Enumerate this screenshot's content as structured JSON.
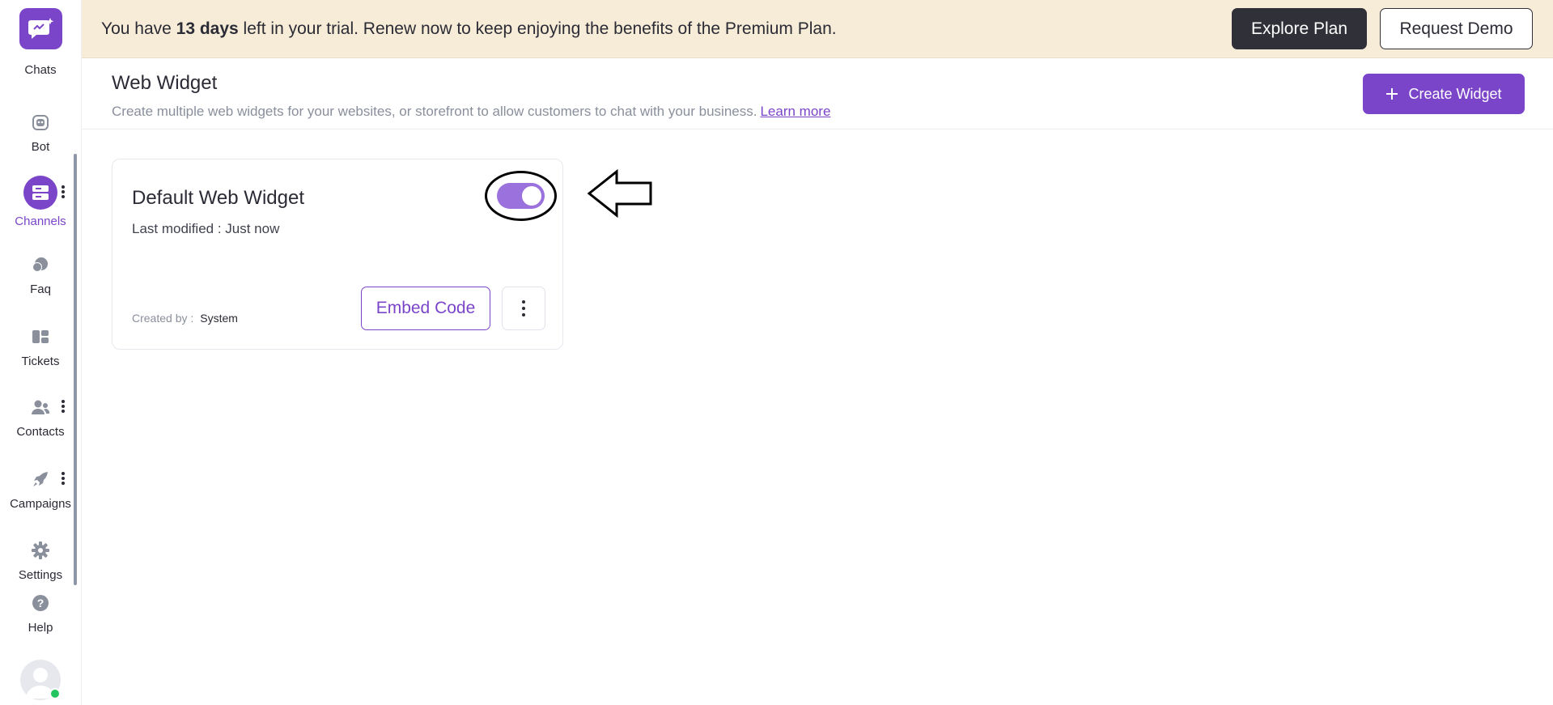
{
  "sidebar": {
    "items": [
      {
        "label": "Chats",
        "icon": "chat-icon"
      },
      {
        "label": "Bot",
        "icon": "bot-icon"
      },
      {
        "label": "Channels",
        "icon": "channels-icon",
        "active": true
      },
      {
        "label": "Faq",
        "icon": "faq-icon"
      },
      {
        "label": "Tickets",
        "icon": "tickets-icon"
      },
      {
        "label": "Contacts",
        "icon": "contacts-icon"
      },
      {
        "label": "Campaigns",
        "icon": "campaigns-icon"
      },
      {
        "label": "Settings",
        "icon": "gear-icon"
      },
      {
        "label": "Help",
        "icon": "help-icon"
      }
    ]
  },
  "banner": {
    "prefix": "You have ",
    "days": "13 days",
    "suffix": " left in your trial. Renew now to keep enjoying the benefits of the Premium Plan.",
    "explore_label": "Explore Plan",
    "demo_label": "Request Demo"
  },
  "header": {
    "title": "Web Widget",
    "description": "Create multiple web widgets for your websites, or storefront to allow customers to chat with your business.",
    "learn_more": "Learn more",
    "create_label": "Create Widget",
    "create_icon": "plus-icon"
  },
  "widget": {
    "name": "Default Web Widget",
    "last_modified": "Last modified : Just now",
    "enabled": true,
    "created_by_label": "Created by :",
    "created_by_value": "System",
    "embed_label": "Embed Code"
  },
  "colors": {
    "accent": "#7b45c9",
    "banner_bg": "#f7ecd7",
    "dark_button": "#2f3038",
    "toggle_on": "#9b72dd",
    "status_online": "#22c55e"
  }
}
